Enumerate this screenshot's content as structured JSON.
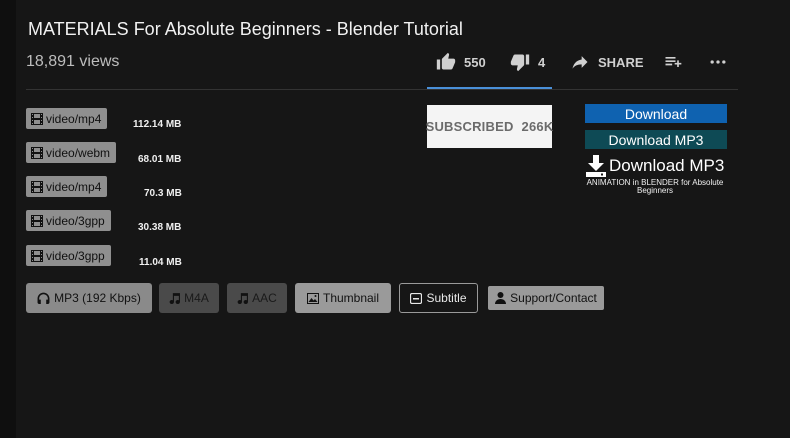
{
  "video": {
    "title": "MATERIALS For Absolute Beginners - Blender Tutorial",
    "views": "18,891 views"
  },
  "actions": {
    "likes": "550",
    "dislikes": "4",
    "share_label": "SHARE"
  },
  "formats": [
    {
      "type": "video/mp4",
      "size": "112.14 MB"
    },
    {
      "type": "video/webm",
      "size": "68.01 MB"
    },
    {
      "type": "video/mp4",
      "size": "70.3 MB"
    },
    {
      "type": "video/3gpp",
      "size": "30.38 MB"
    },
    {
      "type": "video/3gpp",
      "size": "11.04 MB"
    }
  ],
  "subscribe": {
    "label": "SUBSCRIBED",
    "count": "266K"
  },
  "downloads": {
    "download_label": "Download",
    "download_mp3_label": "Download MP3",
    "download_mp3_big_label": "Download MP3",
    "download_mp3_big_sub": "ANIMATION in BLENDER for Absolute Beginners"
  },
  "buttons": {
    "mp3": "MP3 (192 Kbps)",
    "m4a": "M4A",
    "aac": "AAC",
    "thumbnail": "Thumbnail",
    "subtitle": "Subtitle",
    "support": "Support/Contact"
  },
  "colors": {
    "background": "#161616",
    "download_blue": "#0f62b0",
    "download_teal": "#0e4a55",
    "like_bar": "#4a90d9"
  }
}
